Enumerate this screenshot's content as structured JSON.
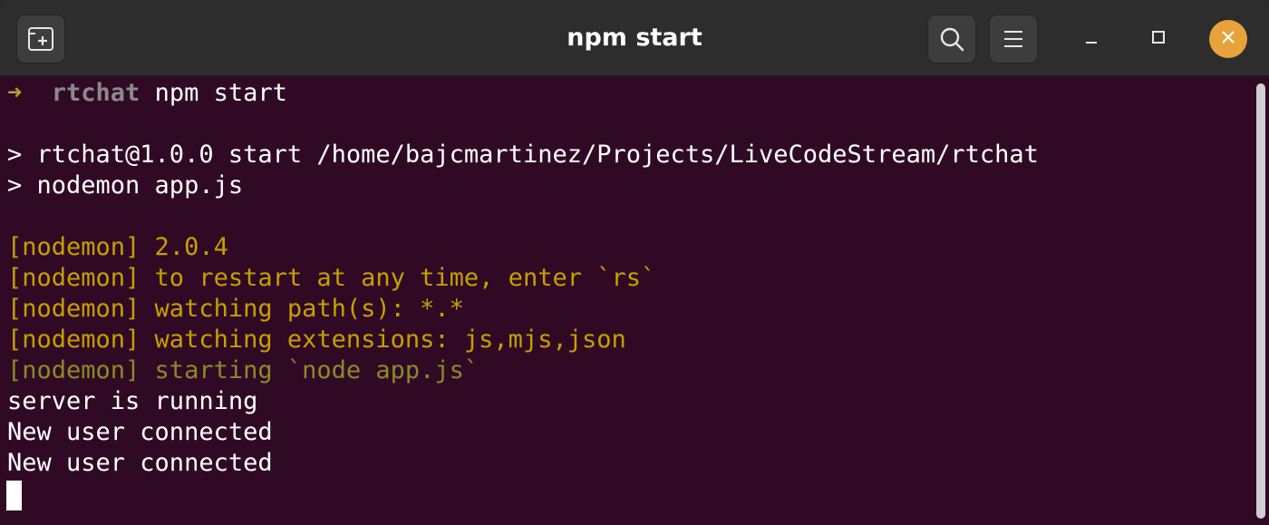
{
  "window": {
    "title": "npm start"
  },
  "icons": {
    "new_tab": "new-tab-icon",
    "search": "search-icon",
    "menu": "hamburger-menu-icon",
    "minimize": "minimize-icon",
    "maximize": "maximize-icon",
    "close": "close-icon"
  },
  "colors": {
    "terminal_background": "#300a24",
    "header_background": "#2d2d2d",
    "nodemon_text": "#c4a000",
    "close_button": "#e9a23b"
  },
  "terminal": {
    "prompt": {
      "arrow": "➜",
      "directory": "rtchat",
      "command": "npm start"
    },
    "lines": [
      "> rtchat@1.0.0 start /home/bajcmartinez/Projects/LiveCodeStream/rtchat",
      "> nodemon app.js",
      "[nodemon] 2.0.4",
      "[nodemon] to restart at any time, enter `rs`",
      "[nodemon] watching path(s): *.*",
      "[nodemon] watching extensions: js,mjs,json",
      "[nodemon] starting `node app.js`",
      "server is running",
      "New user connected",
      "New user connected"
    ]
  }
}
